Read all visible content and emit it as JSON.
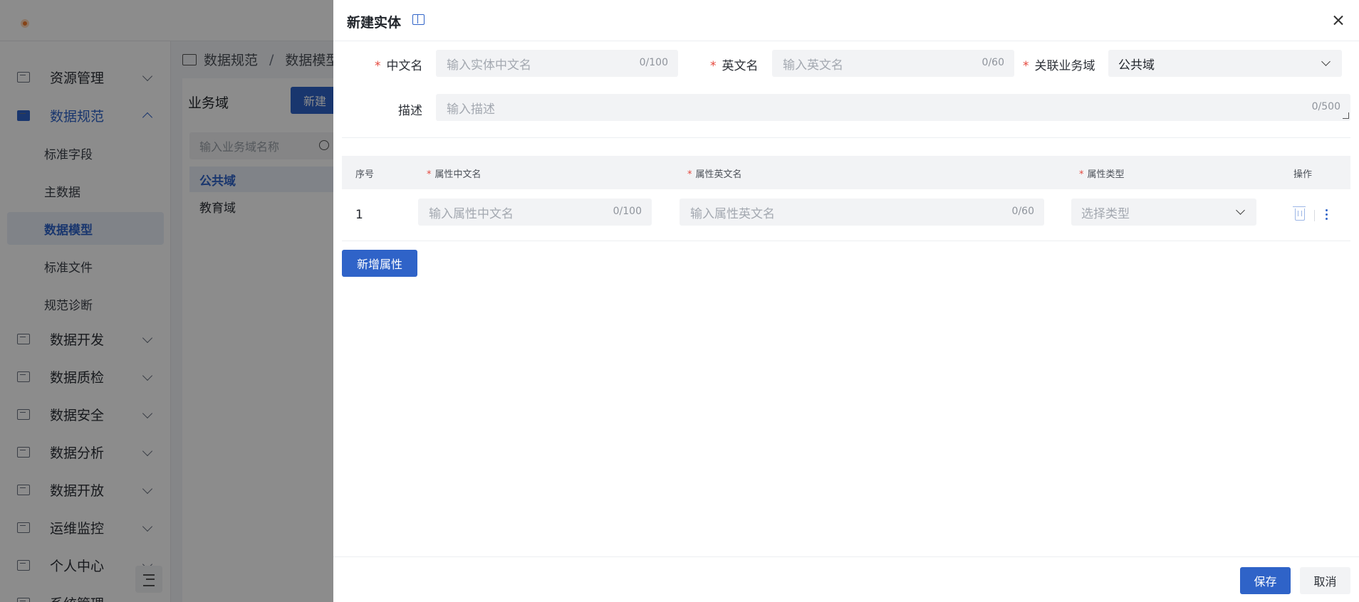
{
  "sidebar": {
    "groups": [
      {
        "label": "资源管理"
      },
      {
        "label": "数据规范"
      },
      {
        "label": "数据开发"
      },
      {
        "label": "数据质检"
      },
      {
        "label": "数据安全"
      },
      {
        "label": "数据分析"
      },
      {
        "label": "数据开放"
      },
      {
        "label": "运维监控"
      },
      {
        "label": "个人中心"
      },
      {
        "label": "系统管理"
      }
    ],
    "sub_items": [
      {
        "label": "标准字段"
      },
      {
        "label": "主数据"
      },
      {
        "label": "数据模型"
      },
      {
        "label": "标准文件"
      },
      {
        "label": "规范诊断"
      }
    ]
  },
  "breadcrumb": {
    "level1": "数据规范",
    "separator": "/",
    "level2": "数据模型"
  },
  "domain_panel": {
    "title": "业务域",
    "new_button": "新建",
    "search_placeholder": "输入业务域名称",
    "items": [
      {
        "label": "公共域"
      },
      {
        "label": "教育域"
      }
    ]
  },
  "drawer": {
    "title": "新建实体",
    "form": {
      "cn_name": {
        "label": "中文名",
        "placeholder": "输入实体中文名",
        "counter": "0/100"
      },
      "en_name": {
        "label": "英文名",
        "placeholder": "输入英文名",
        "counter": "0/60"
      },
      "domain": {
        "label": "关联业务域",
        "value": "公共域"
      },
      "description": {
        "label": "描述",
        "placeholder": "输入描述",
        "counter": "0/500"
      }
    },
    "table": {
      "headers": {
        "index": "序号",
        "attr_cn": "属性中文名",
        "attr_en": "属性英文名",
        "attr_type": "属性类型",
        "actions": "操作"
      },
      "rows": [
        {
          "index": "1",
          "attr_cn_placeholder": "输入属性中文名",
          "attr_cn_counter": "0/100",
          "attr_en_placeholder": "输入属性英文名",
          "attr_en_counter": "0/60",
          "type_placeholder": "选择类型"
        }
      ]
    },
    "add_attribute_button": "新增属性",
    "save_button": "保存",
    "cancel_button": "取消"
  },
  "colors": {
    "primary": "#2f63c8",
    "required": "#e5483d"
  }
}
